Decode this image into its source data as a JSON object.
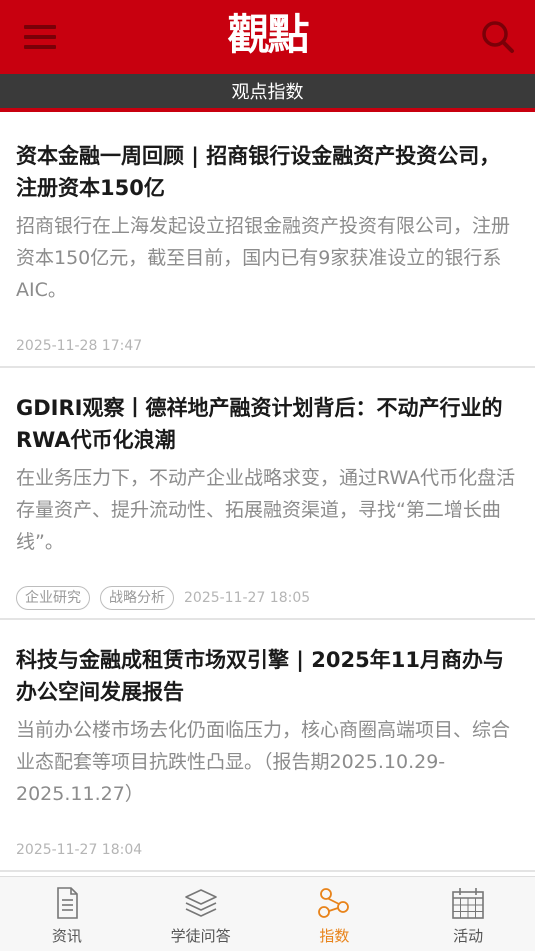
{
  "header": {
    "logo_text": "觀點",
    "subtitle": "观点指数"
  },
  "colors": {
    "brand_red": "#c8000f",
    "subheader_bg": "#3a3a3a",
    "active_tab": "#e8831a"
  },
  "articles": [
    {
      "title": "资本金融一周回顾 | 招商银行设金融资产投资公司，注册资本150亿",
      "summary": "招商银行在上海发起设立招银金融资产投资有限公司，注册资本150亿元，截至目前，国内已有9家获准设立的银行系AIC。",
      "tags": [],
      "time": "2025-11-28 17:47"
    },
    {
      "title": "GDIRI观察丨德祥地产融资计划背后：不动产行业的RWA代币化浪潮",
      "summary": "在业务压力下，不动产企业战略求变，通过RWA代币化盘活存量资产、提升流动性、拓展融资渠道，寻找“第二增长曲线”。",
      "tags": [
        "企业研究",
        "战略分析"
      ],
      "time": "2025-11-27 18:05"
    },
    {
      "title": "科技与金融成租赁市场双引擎 | 2025年11月商办与办公空间发展报告",
      "summary": "当前办公楼市场去化仍面临压力，核心商圈高端项目、综合业态配套等项目抗跌性凸显。（报告期2025.10.29-2025.11.27）",
      "tags": [],
      "time": "2025-11-27 18:04"
    }
  ],
  "tabs": [
    {
      "label": "资讯",
      "icon": "document-icon",
      "active": false
    },
    {
      "label": "学徒问答",
      "icon": "layers-icon",
      "active": false
    },
    {
      "label": "指数",
      "icon": "network-icon",
      "active": true
    },
    {
      "label": "活动",
      "icon": "calendar-icon",
      "active": false
    }
  ]
}
